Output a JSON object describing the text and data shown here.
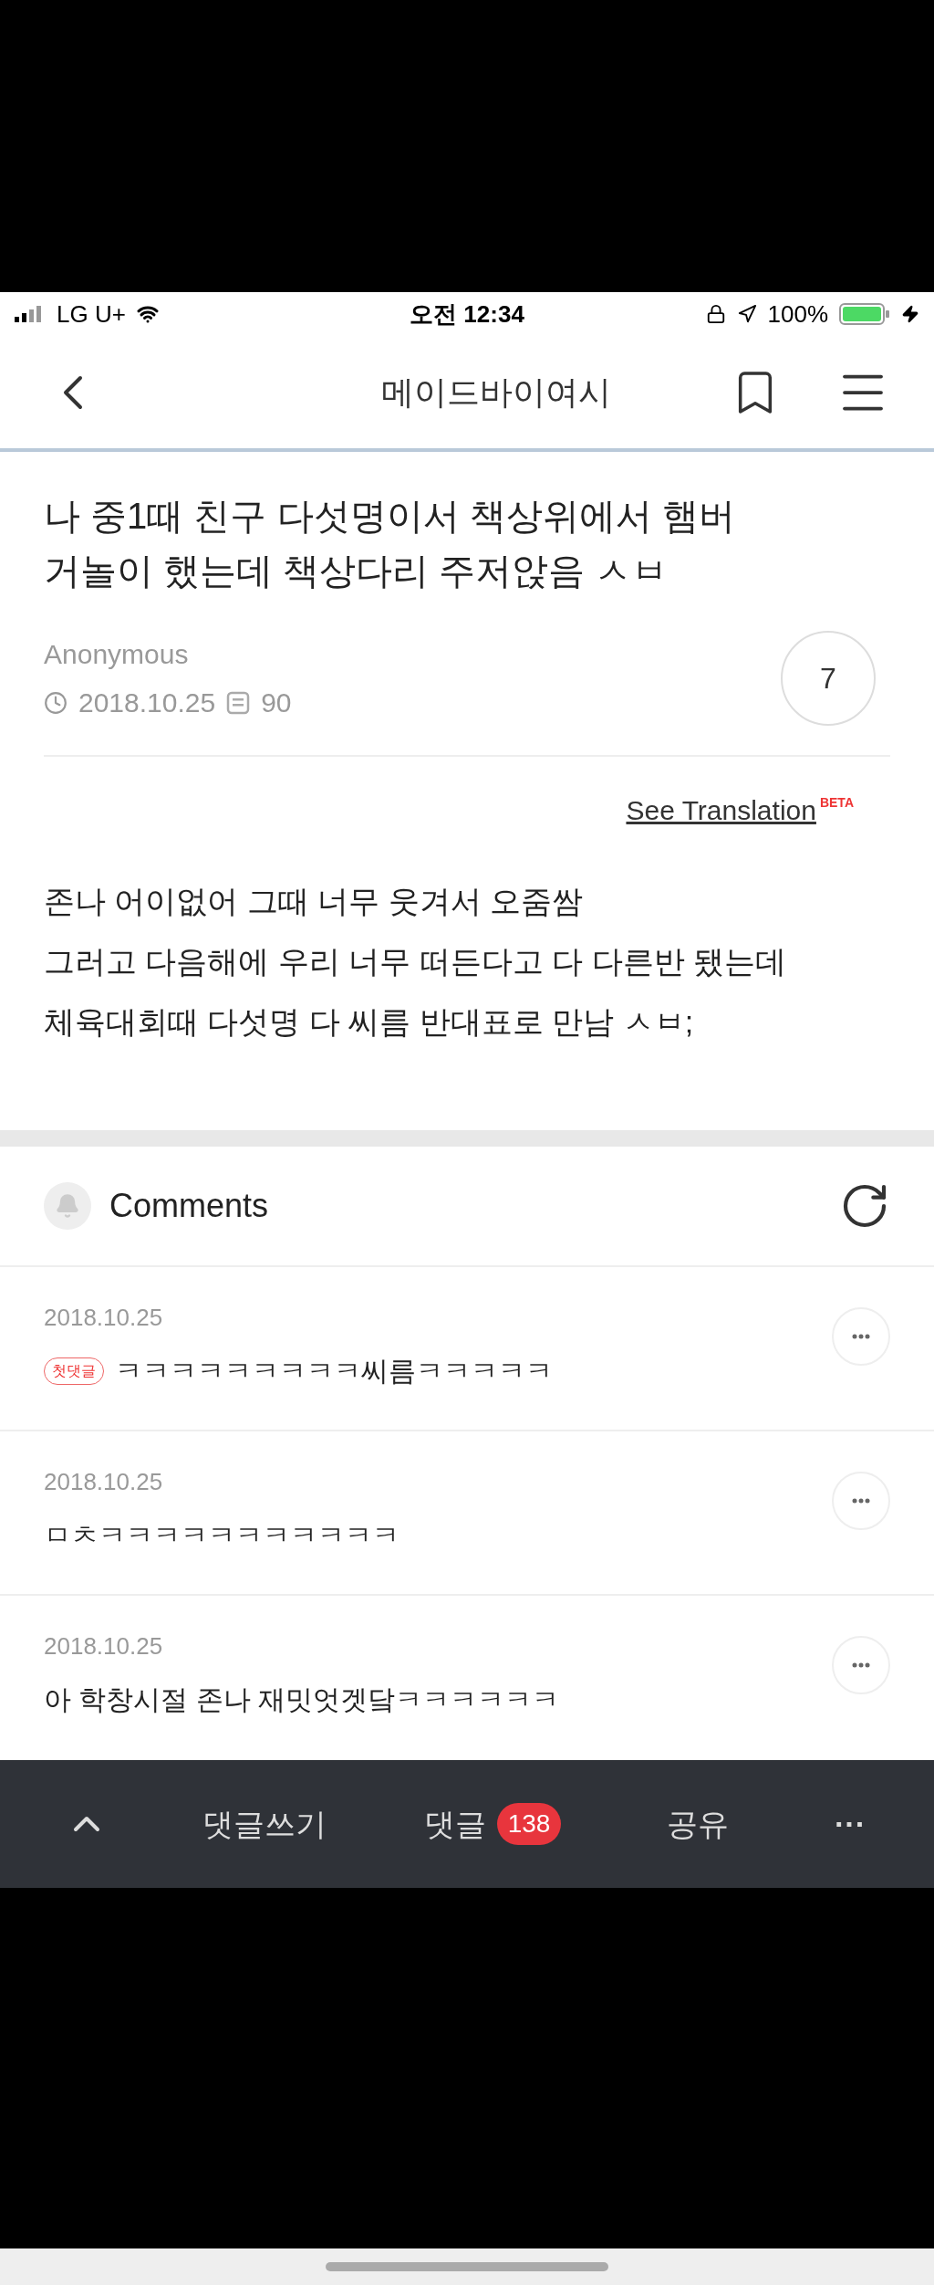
{
  "status_bar": {
    "carrier": "LG U+",
    "time": "오전 12:34",
    "battery": "100%"
  },
  "nav": {
    "title": "메이드바이여시"
  },
  "post": {
    "title": "나 중1때 친구 다섯명이서 책상위에서 햄버거놀이 했는데 책상다리 주저앉음 ㅅㅂ",
    "author": "Anonymous",
    "date": "2018.10.25",
    "views": "90",
    "likes": "7",
    "translate": "See Translation",
    "translate_badge": "BETA",
    "body": [
      "존나 어이없어 그때 너무 웃겨서 오줌쌈",
      "그러고 다음해에 우리 너무 떠든다고 다 다른반 됐는데",
      "체육대회때 다섯명 다 씨름 반대표로 만남 ㅅㅂ;"
    ]
  },
  "comments": {
    "title": "Comments",
    "items": [
      {
        "date": "2018.10.25",
        "badge": "첫댓글",
        "text": "ㅋㅋㅋㅋㅋㅋㅋㅋㅋ씨름ㅋㅋㅋㅋㅋ"
      },
      {
        "date": "2018.10.25",
        "text": "ㅁㅊㅋㅋㅋㅋㅋㅋㅋㅋㅋㅋㅋ"
      },
      {
        "date": "2018.10.25",
        "text": "아 학창시절 존나 재밋엇겟닼ㅋㅋㅋㅋㅋㅋ"
      }
    ]
  },
  "bottom_bar": {
    "write": "댓글쓰기",
    "comments": "댓글",
    "count": "138",
    "share": "공유",
    "more": "···"
  }
}
